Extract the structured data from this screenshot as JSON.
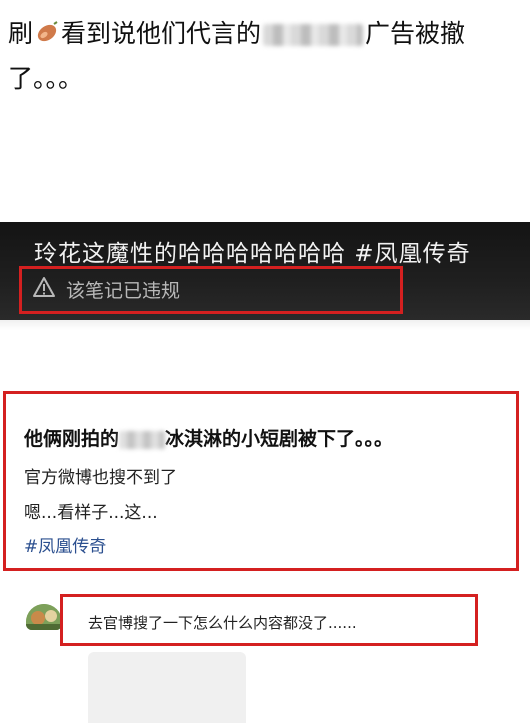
{
  "caption": {
    "before_icon": "刷",
    "icon": "sweet-potato-icon",
    "middle": "看到说他们代言的",
    "after_blur": "广告被撤了。。。"
  },
  "video": {
    "title": "玲花这魔性的哈哈哈哈哈哈哈 #凤凰传奇",
    "warning_icon": "warning-icon",
    "violation_text": "该笔记已违规"
  },
  "post": {
    "title_before": "他俩刚拍的",
    "title_after": "冰淇淋的小短剧被下了。。。",
    "line1": "官方微博也搜不到了",
    "line2": "嗯...看样子...这...",
    "hashtag": "#凤凰传奇"
  },
  "comment": {
    "text": "去官博搜了一下怎么什么内容都没了......"
  },
  "colors": {
    "highlight_red": "#d42020",
    "hashtag_blue": "#2b4f8f",
    "video_bg": "#1a1a1a"
  }
}
